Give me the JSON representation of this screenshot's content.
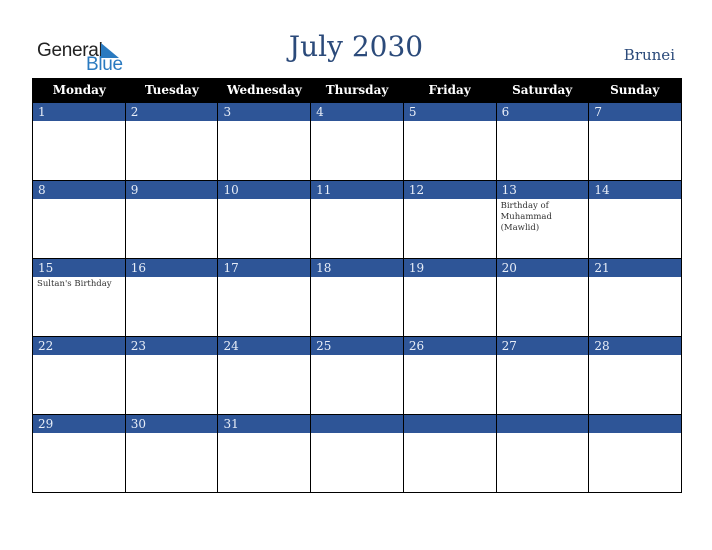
{
  "logo": {
    "word1": "General",
    "word2": "Blue"
  },
  "title": "July 2030",
  "country": "Brunei",
  "colors": {
    "header_bg": "#000000",
    "date_bar": "#2e5597",
    "title": "#2b4a7a",
    "logo_blue": "#2a7ac0"
  },
  "weekdays": [
    "Monday",
    "Tuesday",
    "Wednesday",
    "Thursday",
    "Friday",
    "Saturday",
    "Sunday"
  ],
  "weeks": [
    [
      {
        "day": "1",
        "event": ""
      },
      {
        "day": "2",
        "event": ""
      },
      {
        "day": "3",
        "event": ""
      },
      {
        "day": "4",
        "event": ""
      },
      {
        "day": "5",
        "event": ""
      },
      {
        "day": "6",
        "event": ""
      },
      {
        "day": "7",
        "event": ""
      }
    ],
    [
      {
        "day": "8",
        "event": ""
      },
      {
        "day": "9",
        "event": ""
      },
      {
        "day": "10",
        "event": ""
      },
      {
        "day": "11",
        "event": ""
      },
      {
        "day": "12",
        "event": ""
      },
      {
        "day": "13",
        "event": "Birthday of Muhammad (Mawlid)"
      },
      {
        "day": "14",
        "event": ""
      }
    ],
    [
      {
        "day": "15",
        "event": "Sultan's Birthday"
      },
      {
        "day": "16",
        "event": ""
      },
      {
        "day": "17",
        "event": ""
      },
      {
        "day": "18",
        "event": ""
      },
      {
        "day": "19",
        "event": ""
      },
      {
        "day": "20",
        "event": ""
      },
      {
        "day": "21",
        "event": ""
      }
    ],
    [
      {
        "day": "22",
        "event": ""
      },
      {
        "day": "23",
        "event": ""
      },
      {
        "day": "24",
        "event": ""
      },
      {
        "day": "25",
        "event": ""
      },
      {
        "day": "26",
        "event": ""
      },
      {
        "day": "27",
        "event": ""
      },
      {
        "day": "28",
        "event": ""
      }
    ],
    [
      {
        "day": "29",
        "event": ""
      },
      {
        "day": "30",
        "event": ""
      },
      {
        "day": "31",
        "event": ""
      },
      {
        "day": "",
        "event": ""
      },
      {
        "day": "",
        "event": ""
      },
      {
        "day": "",
        "event": ""
      },
      {
        "day": "",
        "event": ""
      }
    ]
  ]
}
